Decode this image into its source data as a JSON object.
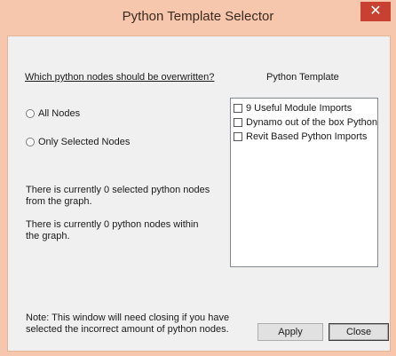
{
  "window": {
    "title": "Python Template Selector",
    "close_glyph": "✕"
  },
  "selection": {
    "question": "Which python nodes should be overwritten?",
    "options": [
      {
        "label": "All Nodes",
        "selected": false
      },
      {
        "label": "Only Selected Nodes",
        "selected": false
      }
    ]
  },
  "info": {
    "selected_text": "There is currently 0 selected python nodes from the graph.",
    "total_text": "There is currently 0 python nodes within the graph."
  },
  "templates": {
    "label": "Python Template",
    "items": [
      {
        "label": "9 Useful Module Imports",
        "checked": false
      },
      {
        "label": "Dynamo out of the box Python Te",
        "checked": false
      },
      {
        "label": "Revit Based Python Imports",
        "checked": false
      }
    ]
  },
  "footer": {
    "note": "Note: This window will need closing if you have selected the incorrect amount of python nodes.",
    "apply_label": "Apply",
    "close_label": "Close"
  },
  "colors": {
    "titlebar": "#f6c7ac",
    "close_button": "#c84031",
    "client": "#f0f0f0"
  }
}
